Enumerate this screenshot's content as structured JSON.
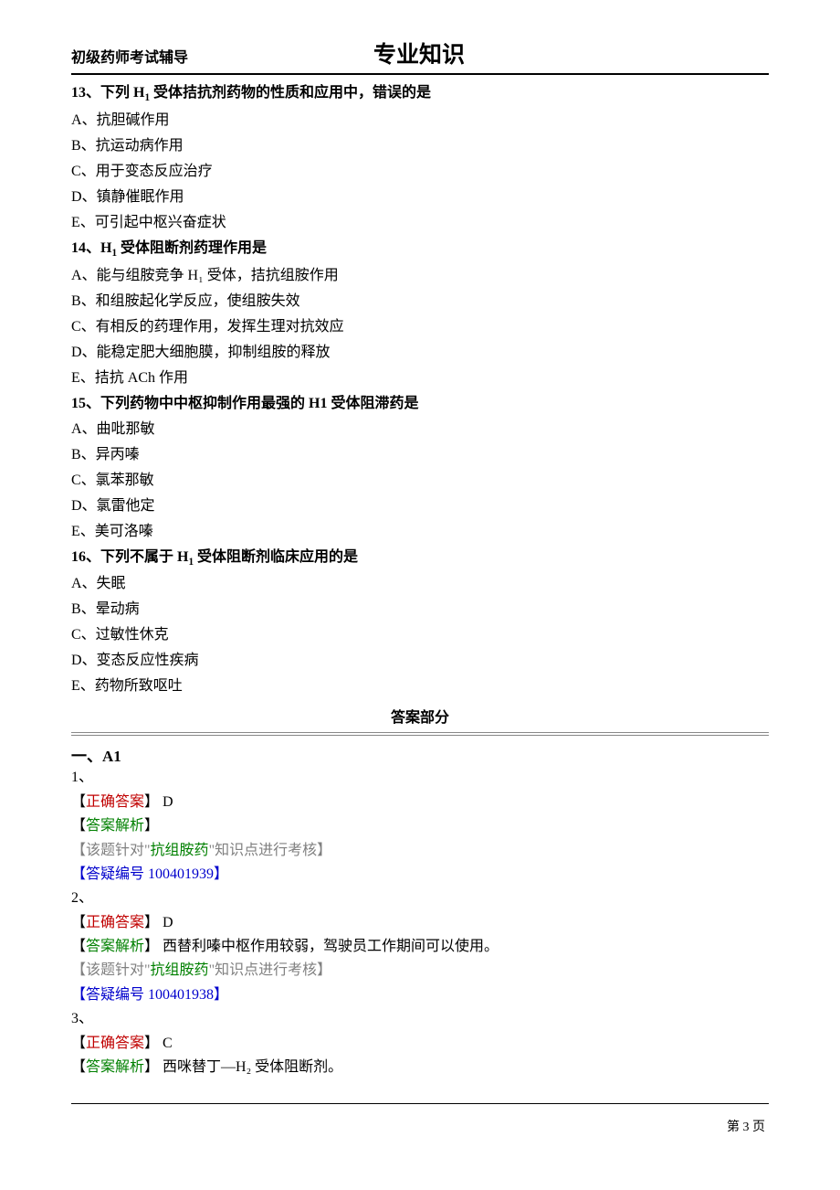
{
  "header": {
    "subtitle": "初级药师考试辅导",
    "title": "专业知识"
  },
  "questions": [
    {
      "stem_prefix": "13、下列 H",
      "stem_sub": "1",
      "stem_suffix": " 受体拮抗剂药物的性质和应用中，错误的是",
      "options": [
        "A、抗胆碱作用",
        "B、抗运动病作用",
        "C、用于变态反应治疗",
        "D、镇静催眠作用",
        "E、可引起中枢兴奋症状"
      ]
    },
    {
      "stem_prefix": "14、H",
      "stem_sub": "1",
      "stem_suffix": " 受体阻断剂药理作用是",
      "options": [
        "A、能与组胺竞争 H₁ 受体，拮抗组胺作用",
        "B、和组胺起化学反应，使组胺失效",
        "C、有相反的药理作用，发挥生理对抗效应",
        "D、能稳定肥大细胞膜，抑制组胺的释放",
        "E、拮抗 ACh 作用"
      ]
    },
    {
      "stem_prefix": "15、下列药物中中枢抑制作用最强的 H1 受体阻滞药是",
      "stem_sub": "",
      "stem_suffix": "",
      "options": [
        "A、曲吡那敏",
        "B、异丙嗪",
        "C、氯苯那敏",
        "D、氯雷他定",
        "E、美可洛嗪"
      ]
    },
    {
      "stem_prefix": "16、下列不属于 H",
      "stem_sub": "1",
      "stem_suffix": " 受体阻断剂临床应用的是",
      "options": [
        "A、失眠",
        "B、晕动病",
        "C、过敏性休克",
        "D、变态反应性疾病",
        "E、药物所致呕吐"
      ]
    }
  ],
  "answers_heading": "答案部分",
  "section_label": "一、A1",
  "answers": [
    {
      "num": "1、",
      "correct_label": "正确答案",
      "correct_value": " D",
      "analysis_label": "答案解析",
      "analysis_text": "",
      "note_prefix": "【该题针对\"",
      "note_topic": "抗组胺药",
      "note_suffix": "\"知识点进行考核】",
      "qa_label": "【答疑编号 100401939】"
    },
    {
      "num": "2、",
      "correct_label": "正确答案",
      "correct_value": " D",
      "analysis_label": "答案解析",
      "analysis_text": " 西替利嗪中枢作用较弱，驾驶员工作期间可以使用。",
      "note_prefix": "【该题针对\"",
      "note_topic": "抗组胺药",
      "note_suffix": "\"知识点进行考核】",
      "qa_label": "【答疑编号 100401938】"
    },
    {
      "num": "3、",
      "correct_label": "正确答案",
      "correct_value": " C",
      "analysis_label": "答案解析",
      "analysis_text": " 西咪替丁—H₂ 受体阻断剂。",
      "note_prefix": "",
      "note_topic": "",
      "note_suffix": "",
      "qa_label": ""
    }
  ],
  "footer": {
    "page": "第 3 页"
  }
}
